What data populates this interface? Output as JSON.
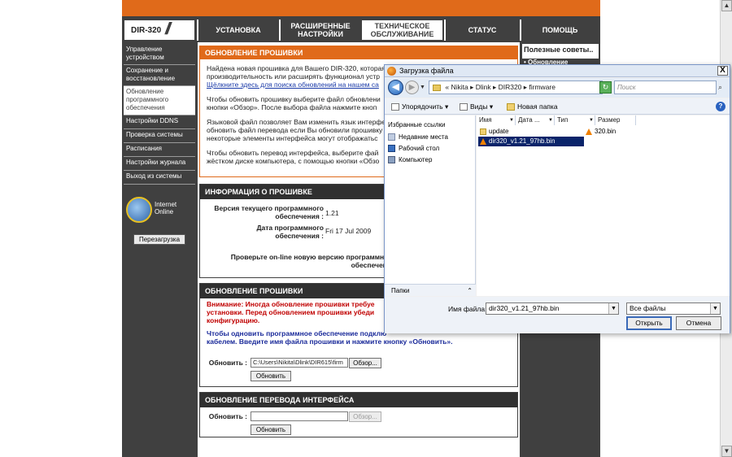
{
  "topnav": {
    "logo": "DIR-320",
    "logo_slash": "//",
    "tabs": [
      {
        "label": "УСТАНОВКА"
      },
      {
        "label": "РАСШИРЕННЫЕ НАСТРОЙКИ"
      },
      {
        "label": "ТЕХНИЧЕСКОЕ ОБСЛУЖИВАНИЕ"
      },
      {
        "label": "СТАТУС"
      },
      {
        "label": "ПОМОЩЬ"
      }
    ]
  },
  "sidebar": {
    "items": [
      {
        "label": "Управление устройством"
      },
      {
        "label": "Сохранение и восстановление"
      },
      {
        "label": "Обновление программного обеспечения"
      },
      {
        "label": "Настройки DDNS"
      },
      {
        "label": "Проверка системы"
      },
      {
        "label": "Расписания"
      },
      {
        "label": "Настройки журнала"
      },
      {
        "label": "Выход из системы"
      }
    ],
    "internet_status": "Internet Online",
    "reboot_label": "Перезагрузка"
  },
  "right_col": {
    "title": "Полезные советы..",
    "item": "• Обновление"
  },
  "main": {
    "update_section": {
      "title": "ОБНОВЛЕНИЕ ПРОШИВКИ",
      "p1_line1": "Найдена новая прошивка для Вашего DIR-320, которая",
      "p1_line2": "производительность или расширять функционал устр",
      "p1_link": "Щёлкните здесь для поиска обновлений на нашем са",
      "p2_line1": "Чтобы обновить прошивку выберите файл обновлени",
      "p2_line2": "кнопки «Обзор». После выбора файла нажмите кноп",
      "p3_line1": "Языковой файл позволяет Вам изменить язык интерфей",
      "p3_line2": "обновить файл перевода если Вы обновили прошивку",
      "p3_line3": "некоторые элементы интерфейса могут отображатьс",
      "p4_line1": "Чтобы обновить перевод интерфейса, выберите фай",
      "p4_line2": "жёстком диске компьютера, с помощью кнопки «Обзо"
    },
    "info_section": {
      "title": "ИНФОРМАЦИЯ О ПРОШИВКЕ",
      "current_label": "Версия текущего программного обеспечения :",
      "current_value": "1.21",
      "date_label": "Дата программного обеспечения :",
      "date_value": "Fri 17 Jul 2009",
      "check_text": "Проверьте on-line новую версию программного обеспечения"
    },
    "firmware_section": {
      "title": "ОБНОВЛЕНИЕ ПРОШИВКИ",
      "warning_line1": "Внимание: Иногда обновление прошивки требуе",
      "warning_line2": "установки. Перед обновлением прошивки убеди",
      "warning_line3": "конфигурацию.",
      "info_line1": "Чтобы одновить программное обеспечение подклю",
      "info_line2": "кабелем. Введите имя файла прошивки и нажмите кнопку «Обновить».",
      "upload_label": "Обновить :",
      "file_value": "C:\\Users\\Nikita\\Dlink\\DIR615\\firm",
      "browse_label": "Обзор...",
      "update_button": "Обновить"
    },
    "lang_section": {
      "title": "ОБНОВЛЕНИЕ ПЕРЕВОДА ИНТЕРФЕЙСА",
      "upload_label": "Обновить :",
      "file_value": "",
      "browse_label": "Обзор...",
      "update_button": "Обновить"
    }
  },
  "dialog": {
    "title": "Загрузка файла",
    "close": "X",
    "address_parts": "« Nikita ▸ Dlink ▸ DIR320 ▸ firmware",
    "search_placeholder": "Поиск",
    "toolbar": {
      "organize": "Упорядочить ▾",
      "views": "Виды ▾",
      "new_folder": "Новая папка"
    },
    "nav": {
      "favorites": "Избранные ссылки",
      "items": [
        {
          "label": "Недавние места"
        },
        {
          "label": "Рабочий стол"
        },
        {
          "label": "Компьютер"
        }
      ],
      "folders": "Папки"
    },
    "columns": [
      {
        "label": "Имя"
      },
      {
        "label": "Дата ..."
      },
      {
        "label": "Тип"
      },
      {
        "label": "Размер"
      }
    ],
    "files": [
      {
        "name": "update"
      },
      {
        "name": "dir320_v1.21_97hb.bin"
      },
      {
        "name": "320.bin"
      }
    ],
    "filename_label": "Имя файла:",
    "filename_value": "dir320_v1.21_97hb.bin",
    "filetype_value": "Все файлы",
    "open_button": "Открыть",
    "cancel_button": "Отмена"
  },
  "colors": {
    "accent_orange": "#e06a1a",
    "dark_gray": "#404040",
    "selection_blue": "#0a246a"
  }
}
